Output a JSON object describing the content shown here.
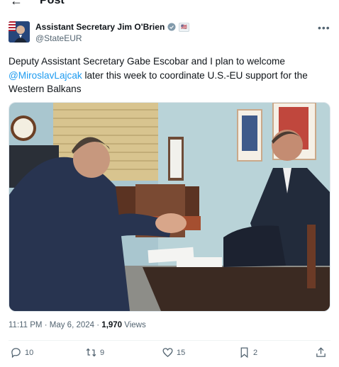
{
  "header": {
    "title": "Post"
  },
  "author": {
    "name": "Assistant Secretary Jim O'Brien",
    "handle": "@StateEUR",
    "gov_badge": "🇺🇸"
  },
  "tweet": {
    "text_before": "Deputy Assistant Secretary Gabe Escobar and I plan to welcome ",
    "mention": "@MiroslavLajcak",
    "text_after": " later this week to coordinate U.S.-EU support for the Western Balkans"
  },
  "meta": {
    "time": "11:11 PM",
    "separator": " · ",
    "date": "May 6, 2024",
    "views_count": "1,970",
    "views_label": " Views"
  },
  "actions": {
    "replies": "10",
    "reposts": "9",
    "likes": "15",
    "bookmarks": "2"
  },
  "colors": {
    "accent": "#1d9bf0",
    "muted": "#536471"
  }
}
